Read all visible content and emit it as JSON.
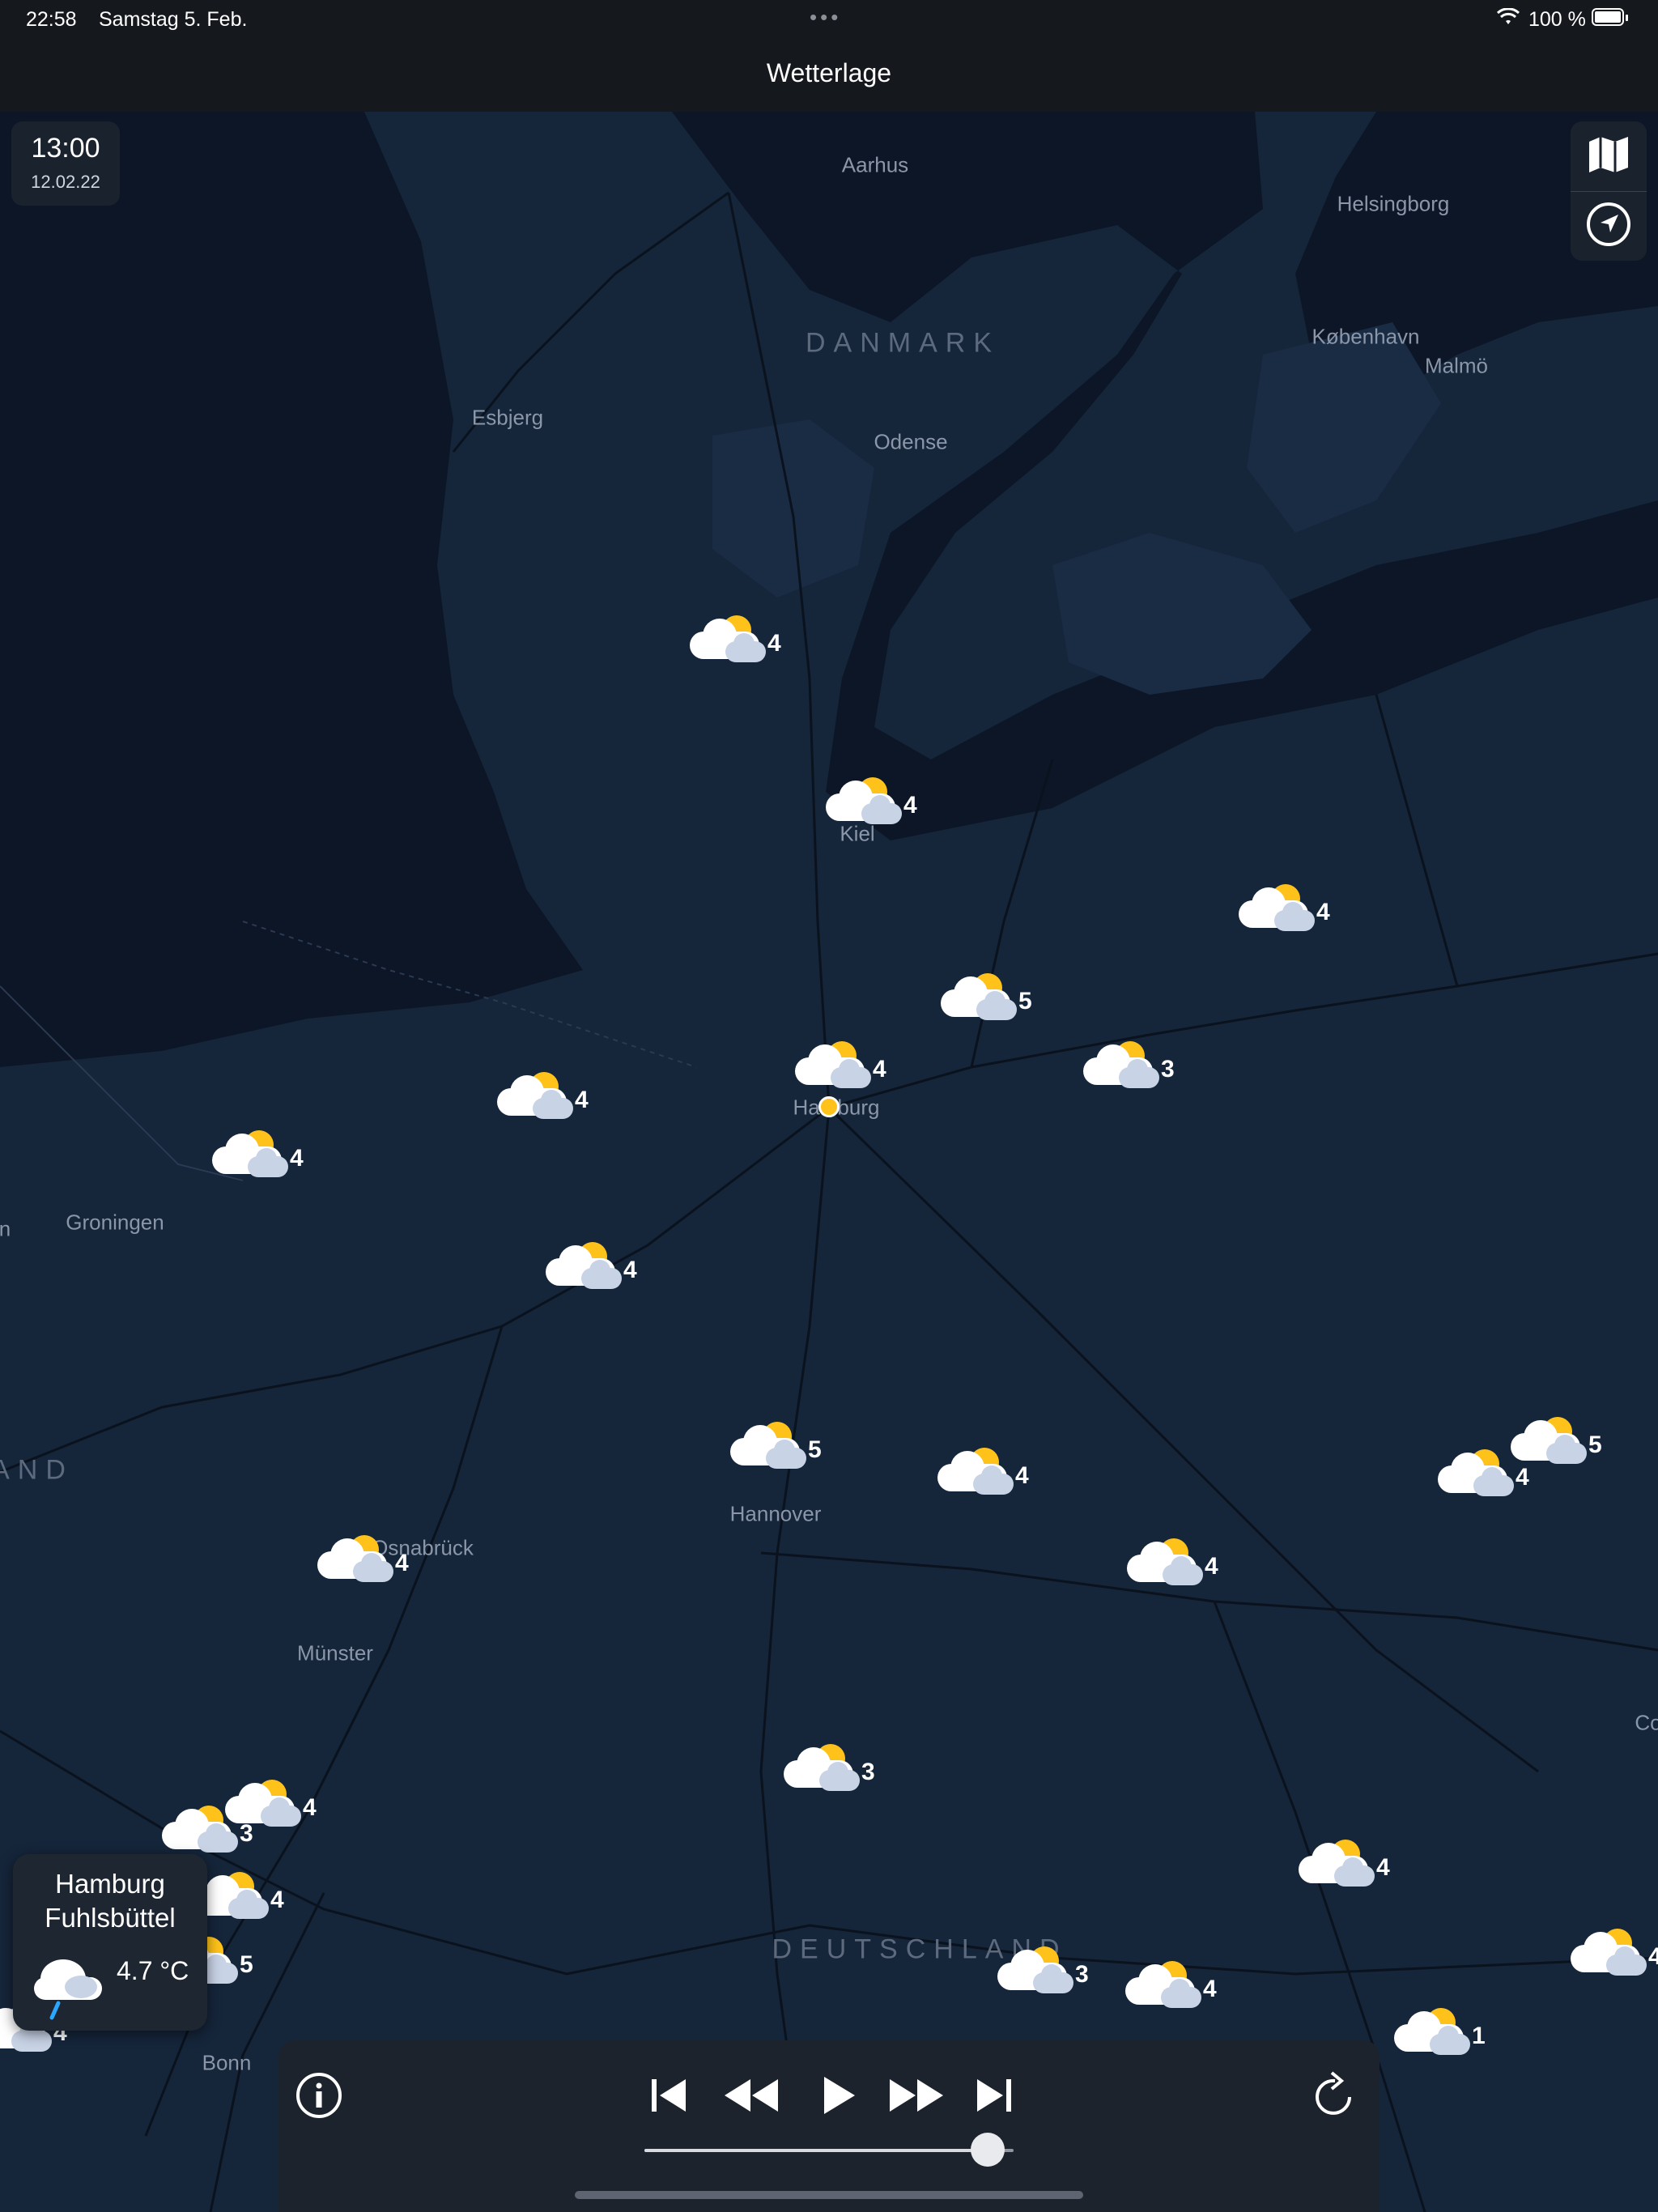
{
  "status_bar": {
    "time": "22:58",
    "date": "Samstag 5. Feb.",
    "battery": "100 %"
  },
  "nav": {
    "title": "Wetterlage"
  },
  "time_box": {
    "time": "13:00",
    "date": "12.02.22"
  },
  "map_controls": {
    "map_icon": "map-icon",
    "location_icon": "location-arrow-icon"
  },
  "places": [
    "Aarhus",
    "Helsingborg",
    "København",
    "Malmö",
    "Esbjerg",
    "Odense",
    "Kiel",
    "Groningen",
    "Osnabrück",
    "Münster",
    "Hannover",
    "Bonn",
    "n",
    "Co"
  ],
  "countries": [
    "DANMARK",
    "DEUTSCHLAND",
    "AND"
  ],
  "weather_markers": [
    "4",
    "4",
    "4",
    "5",
    "4",
    "3",
    "4",
    "4",
    "4",
    "5",
    "4",
    "5",
    "4",
    "4",
    "4",
    "3",
    "4",
    "3",
    "5",
    "4",
    "3",
    "4",
    "1",
    "4",
    "4",
    "4"
  ],
  "info_card": {
    "name_line1": "Hamburg",
    "name_line2": "Fuhlsbüttel",
    "temperature": "4.7 °C",
    "icon": "rain-cloud-icon"
  },
  "player": {
    "info_icon": "info-icon",
    "skip_back_icon": "skip-to-start-icon",
    "rewind_icon": "rewind-icon",
    "play_icon": "play-icon",
    "forward_icon": "fast-forward-icon",
    "skip_end_icon": "skip-to-end-icon",
    "refresh_icon": "refresh-icon",
    "progress": 0.93
  },
  "colors": {
    "accent_sun": "#ffc21a",
    "map_bg": "#132236",
    "sea": "#0c1627",
    "land": "#1a2c44"
  }
}
